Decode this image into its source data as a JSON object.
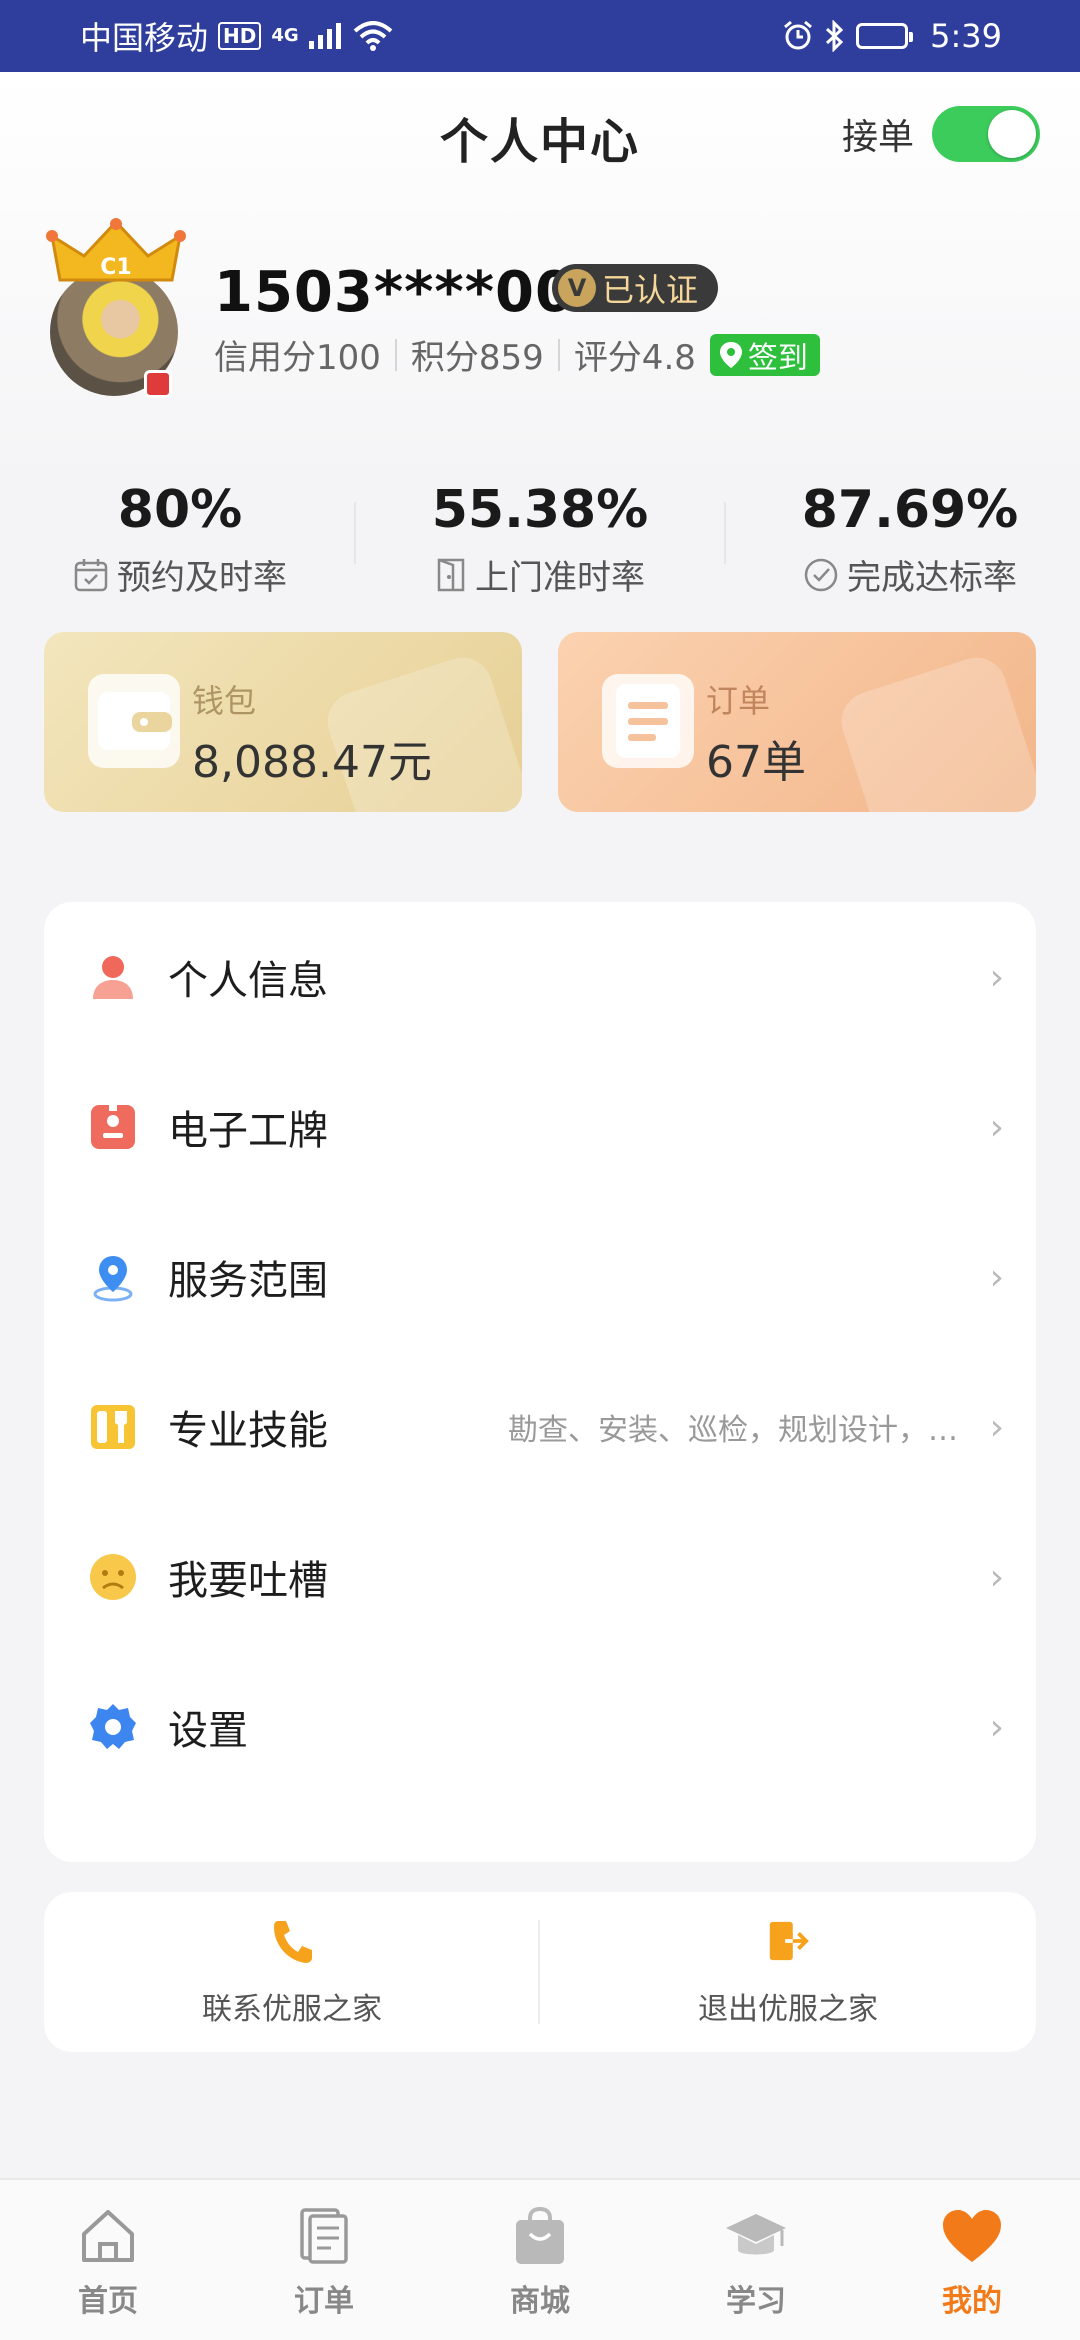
{
  "status_bar": {
    "carrier": "中国移动",
    "hd": "HD",
    "network": "4G",
    "time": "5:39"
  },
  "header": {
    "title": "个人中心",
    "accept_orders_label": "接单",
    "accept_orders_on": true
  },
  "profile": {
    "phone": "1503****009",
    "crown_level": "C1",
    "verified_badge": "已认证",
    "verified_mark": "V",
    "credit": "信用分100",
    "points": "积分859",
    "rating": "评分4.8",
    "signin_label": "签到"
  },
  "stats": [
    {
      "value": "80%",
      "label": "预约及时率",
      "icon": "calendar-check-icon"
    },
    {
      "value": "55.38%",
      "label": "上门准时率",
      "icon": "door-icon"
    },
    {
      "value": "87.69%",
      "label": "完成达标率",
      "icon": "check-circle-icon"
    }
  ],
  "cards": {
    "wallet": {
      "title": "钱包",
      "value": "8,088.47元",
      "icon": "wallet-icon"
    },
    "orders": {
      "title": "订单",
      "value": "67单",
      "icon": "document-icon"
    }
  },
  "menu": [
    {
      "label": "个人信息",
      "desc": "",
      "icon": "person-icon"
    },
    {
      "label": "电子工牌",
      "desc": "",
      "icon": "badge-card-icon"
    },
    {
      "label": "服务范围",
      "desc": "",
      "icon": "location-pin-icon"
    },
    {
      "label": "专业技能",
      "desc": "勘查、安装、巡检，规划设计，…",
      "icon": "wrench-icon"
    },
    {
      "label": "我要吐槽",
      "desc": "",
      "icon": "sad-face-icon"
    },
    {
      "label": "设置",
      "desc": "",
      "icon": "gear-icon"
    }
  ],
  "contact": {
    "contact_label": "联系优服之家",
    "exit_label": "退出优服之家"
  },
  "tabs": [
    {
      "label": "首页",
      "icon": "home-icon",
      "active": false
    },
    {
      "label": "订单",
      "icon": "orders-icon",
      "active": false
    },
    {
      "label": "商城",
      "icon": "shopping-bag-icon",
      "active": false
    },
    {
      "label": "学习",
      "icon": "graduation-cap-icon",
      "active": false
    },
    {
      "label": "我的",
      "icon": "heart-icon",
      "active": true
    }
  ],
  "colors": {
    "status_bar": "#2f3d9c",
    "toggle_on": "#3ccc5c",
    "signin_green": "#2ec03d",
    "active_tab": "#f27a18"
  }
}
